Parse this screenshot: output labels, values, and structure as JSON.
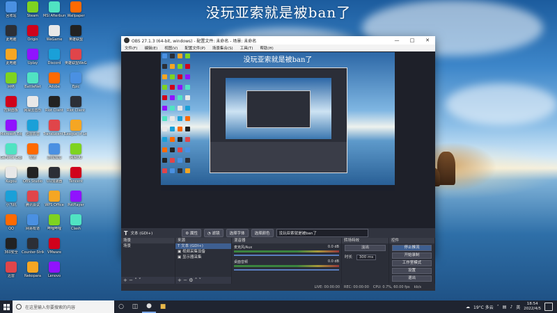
{
  "desktop": {
    "banner_text": "没玩亚索就是被ban了",
    "icons_col1": [
      "回收站",
      "此电脑",
      "此电脑",
      "网络",
      "控制面板",
      "Microsoft Edge",
      "GeForce Experience",
      "Kugou",
      "小飞机",
      "QQ",
      "360安全",
      "迅雷"
    ],
    "icons_col2": [
      "Steam",
      "Origin",
      "Uplay",
      "BattleNet",
      "网易云音乐",
      "迅雷影音",
      "有道",
      "OBS Studio",
      "腾讯会议",
      "网易有道",
      "Counter-Strike Global Off",
      "Nekopara"
    ],
    "icons_col3": [
      "MSI Afterburner",
      "WeGame",
      "Discord",
      "Adobe",
      "Riot Client",
      "TranslucentTB",
      "游戏加加",
      "UU加速器",
      "WPS Office",
      "哔哩哔哩",
      "VMware",
      "Lenovo"
    ],
    "icons_col4": [
      "Wallpaper",
      "英雄联盟",
      "英雄联盟WeGame",
      "Epic",
      "Riot Client",
      "League of Legends",
      "网易UU",
      "Tencent",
      "PotPlayer",
      "Clash"
    ]
  },
  "obs": {
    "title": "OBS 27.1.3 (64-bit, windows) - 配置文件: 未命名 - 场景: 未命名",
    "menu": [
      "文件(F)",
      "编辑(E)",
      "视图(V)",
      "配置文件(P)",
      "场景集合(S)",
      "工具(T)",
      "帮助(H)"
    ],
    "canvas_text": "没玩亚索就是被ban了",
    "source_toolbar": {
      "source_name": "文本 (GDI+)",
      "props": "属性",
      "filters": "滤镜",
      "font": "选择字体",
      "color": "选择颜色",
      "text_value": "没玩亚索就是被ban了"
    },
    "docks": {
      "scenes_title": "场景",
      "scenes": [
        "场景"
      ],
      "sources_title": "来源",
      "sources": [
        "文本 (GDI+)",
        "视频采集设备",
        "显示器采集"
      ],
      "mixer_title": "混音器",
      "mixer_channels": [
        {
          "name": "桌面音频",
          "db": "0.0 dB"
        },
        {
          "name": "麦克风/Aux",
          "db": "0.0 dB"
        },
        {
          "name": "桌面音频",
          "db": "0.0 dB"
        }
      ],
      "transitions_title": "转场特效",
      "transition_type": "淡出",
      "duration_label": "时长",
      "duration_value": "300 ms",
      "controls_title": "控件",
      "controls": [
        "停止推流",
        "开始录制",
        "工作室模式",
        "设置",
        "退出"
      ]
    },
    "status": {
      "live": "LIVE: 00:00:00",
      "rec": "REC: 00:00:00",
      "cpu": "CPU: 0.7%, 60.00 fps",
      "kbps": "kb/s"
    }
  },
  "taskbar": {
    "search_placeholder": "在这里输入你要搜索的内容",
    "weather": "19°C 多云",
    "time": "18:54",
    "date": "2022/4/5",
    "lang": "英"
  }
}
